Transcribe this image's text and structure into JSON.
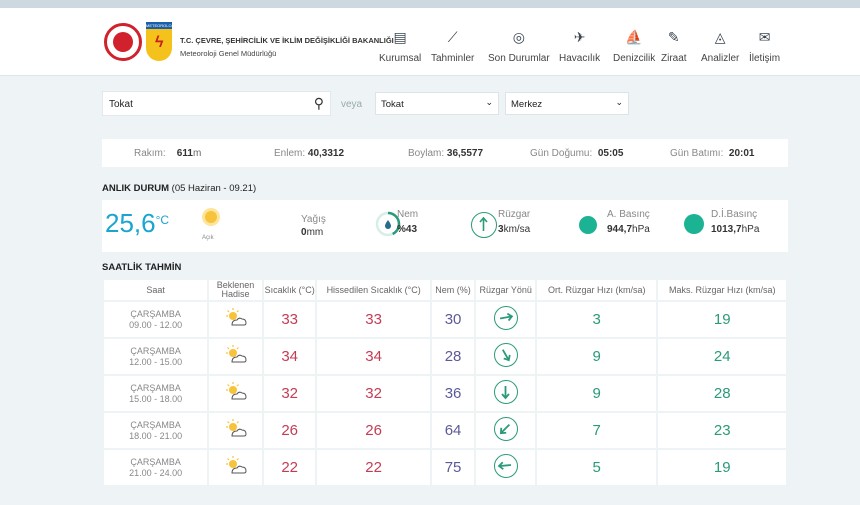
{
  "header": {
    "org_line1": "T.C. ÇEVRE, ŞEHİRCİLİK VE İKLİM DEĞİŞİKLİĞİ BAKANLIĞI",
    "org_line2": "Meteoroloji Genel Müdürlüğü",
    "logo_text": "METEOROLOJİ",
    "nav": [
      {
        "label": "Kurumsal",
        "icon": "document-icon",
        "glyph": "▤"
      },
      {
        "label": "Tahminler",
        "icon": "chart-icon",
        "glyph": "⟋"
      },
      {
        "label": "Son Durumlar",
        "icon": "check-circle-icon",
        "glyph": "◎"
      },
      {
        "label": "Havacılık",
        "icon": "plane-icon",
        "glyph": "✈"
      },
      {
        "label": "Denizcilik",
        "icon": "sail-icon",
        "glyph": "⛵"
      },
      {
        "label": "Ziraat",
        "icon": "leaf-icon",
        "glyph": "✎"
      },
      {
        "label": "Analizler",
        "icon": "analysis-icon",
        "glyph": "◬"
      },
      {
        "label": "İletişim",
        "icon": "mail-icon",
        "glyph": "✉"
      }
    ]
  },
  "search": {
    "value": "Tokat",
    "connector": "veya",
    "province": "Tokat",
    "district": "Merkez"
  },
  "info": {
    "rakim_label": "Rakım:",
    "rakim_value": "611",
    "rakim_unit": "m",
    "enlem_label": "Enlem:",
    "enlem_value": "40,3312",
    "boylam_label": "Boylam:",
    "boylam_value": "36,5577",
    "dogum_label": "Gün Doğumu:",
    "dogum_value": "05:05",
    "batim_label": "Gün Batımı:",
    "batim_value": "20:01"
  },
  "current": {
    "title": "ANLIK DURUM",
    "time": "(05 Haziran - 09.21)",
    "temp": "25,6",
    "temp_unit": "°C",
    "condition": "Açık",
    "yagis_label": "Yağış",
    "yagis_value": "0",
    "yagis_unit": "mm",
    "nem_label": "Nem",
    "nem_value": "%43",
    "nem_fraction": 0.43,
    "ruzgar_label": "Rüzgar",
    "ruzgar_value": "3",
    "ruzgar_unit": "km/sa",
    "abasinc_label": "A. Basınç",
    "abasinc_value": "944,7",
    "abasinc_unit": "hPa",
    "dibasinc_label": "D.İ.Basınç",
    "dibasinc_value": "1013,7",
    "dibasinc_unit": "hPa"
  },
  "hourly": {
    "title": "SAATLİK TAHMİN",
    "headers": [
      "Saat",
      "Beklenen Hadise",
      "Sıcaklık (°C)",
      "Hissedilen Sıcaklık (°C)",
      "Nem (%)",
      "Rüzgar Yönü",
      "Ort. Rüzgar Hızı (km/sa)",
      "Maks. Rüzgar Hızı (km/sa)"
    ],
    "rows": [
      {
        "day": "ÇARŞAMBA",
        "time": "09.00 - 12.00",
        "temp": "33",
        "feels": "33",
        "humidity": "30",
        "wind_dir_deg": 80,
        "wind_avg": "3",
        "wind_max": "19"
      },
      {
        "day": "ÇARŞAMBA",
        "time": "12.00 - 15.00",
        "temp": "34",
        "feels": "34",
        "humidity": "28",
        "wind_dir_deg": 150,
        "wind_avg": "9",
        "wind_max": "24"
      },
      {
        "day": "ÇARŞAMBA",
        "time": "15.00 - 18.00",
        "temp": "32",
        "feels": "32",
        "humidity": "36",
        "wind_dir_deg": 180,
        "wind_avg": "9",
        "wind_max": "28"
      },
      {
        "day": "ÇARŞAMBA",
        "time": "18.00 - 21.00",
        "temp": "26",
        "feels": "26",
        "humidity": "64",
        "wind_dir_deg": 225,
        "wind_avg": "7",
        "wind_max": "23"
      },
      {
        "day": "ÇARŞAMBA",
        "time": "21.00 - 24.00",
        "temp": "22",
        "feels": "22",
        "humidity": "75",
        "wind_dir_deg": 265,
        "wind_avg": "5",
        "wind_max": "19"
      }
    ]
  },
  "colors": {
    "temp": "#1aa5d1",
    "red": "#c43c54",
    "purple": "#5a5a9a",
    "green": "#2a9a7a"
  }
}
